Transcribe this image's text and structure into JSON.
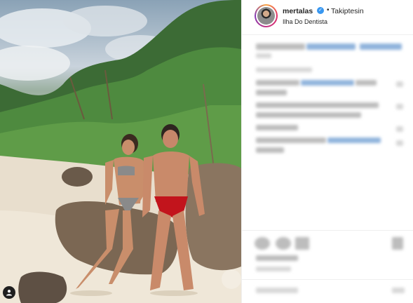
{
  "post": {
    "username": "mertalas",
    "follow_status": "Takiptesin",
    "separator": "•",
    "location": "Ilha Do Dentista",
    "verified_icon": "verified-badge-icon"
  },
  "colors": {
    "verified_blue": "#3897f0",
    "text": "#262626",
    "divider": "#efefef"
  },
  "photo": {
    "icon": "user-tag-icon"
  }
}
